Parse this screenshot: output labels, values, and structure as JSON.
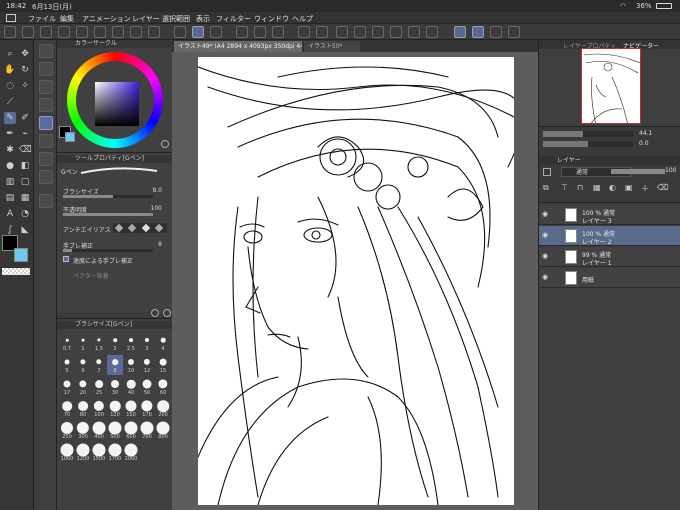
{
  "status": {
    "time": "18:42",
    "date": "6月13日(月)",
    "battery": "36%"
  },
  "menu": [
    "ファイル",
    "編集",
    "アニメーション",
    "レイヤー",
    "選択範囲",
    "表示",
    "フィルター",
    "ウィンドウ",
    "ヘルプ"
  ],
  "panels": {
    "color_circle": "カラーサークル",
    "tool_property": "ツールプロパティ[Gペン]",
    "brush_size": "ブラシサイズ[Gペン]"
  },
  "tool_property": {
    "brush_name": "Gペン",
    "size_label": "ブラシサイズ",
    "size_value": "8.0",
    "size_fraction": 0.55,
    "opacity_label": "不透明度",
    "opacity_value": "100",
    "opacity_fraction": 1.0,
    "antialias_label": "アンチエイリアス",
    "stabilize_label": "手ブレ補正",
    "stabilize_value": "8",
    "stabilize_fraction": 0.1,
    "speed_stabilize_label": "速度による手ブレ補正",
    "vector_label": "ベクター吸着"
  },
  "brush_sizes": [
    "0.7",
    "1",
    "1.5",
    "2",
    "2.5",
    "3",
    "4",
    "5",
    "6",
    "7",
    "8",
    "10",
    "12",
    "15",
    "17",
    "20",
    "25",
    "30",
    "40",
    "50",
    "60",
    "70",
    "80",
    "100",
    "120",
    "150",
    "170",
    "200",
    "250",
    "300",
    "400",
    "500",
    "600",
    "700",
    "800",
    "1000",
    "1200",
    "1500",
    "1700",
    "2000"
  ],
  "brush_size_selected": "8",
  "canvas": {
    "tab_active": "イラスト49* (A4 2894 x 4093px 350dpi 44.1%)",
    "tab_other": "イラスト50*"
  },
  "navigator": {
    "tabs": [
      "レイヤープロパティ",
      "ナビゲーター"
    ],
    "zoom": "44.1",
    "rotation": "0.0"
  },
  "layer_panel": {
    "title": "レイヤー",
    "blend_mode": "通常",
    "opacity": "100",
    "layers": [
      {
        "mode": "100 % 通常",
        "name": "レイヤー 3",
        "selected": false
      },
      {
        "mode": "100 % 通常",
        "name": "レイヤー 2",
        "selected": true
      },
      {
        "mode": "99 % 通常",
        "name": "レイヤー 1",
        "selected": false
      },
      {
        "mode": "",
        "name": "用紙",
        "selected": false
      }
    ]
  }
}
